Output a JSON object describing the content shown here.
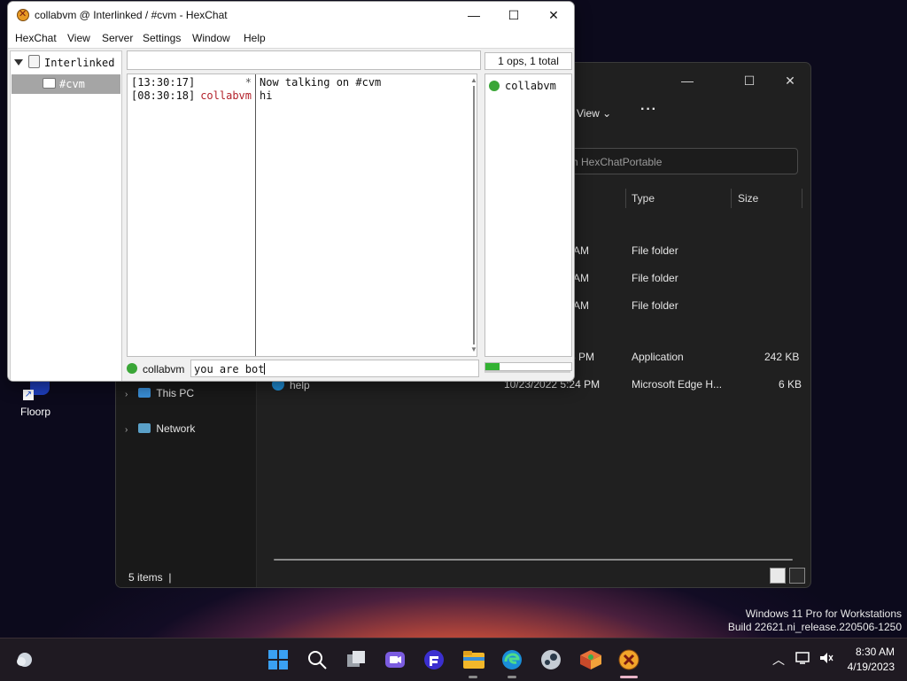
{
  "desktop": {
    "icon_label": "Floorp",
    "watermark_line1": "Windows 11 Pro for Workstations",
    "watermark_line2": "Build 22621.ni_release.220506-1250"
  },
  "explorer": {
    "view_label": "View",
    "more_label": "···",
    "search_placeholder": "h HexChatPortable",
    "columns": {
      "type": "Type",
      "size": "Size"
    },
    "rows": [
      {
        "date": "AM",
        "type": "File folder",
        "size": ""
      },
      {
        "date": "AM",
        "type": "File folder",
        "size": ""
      },
      {
        "date": "AM",
        "type": "File folder",
        "size": ""
      },
      {
        "date": "5 PM",
        "type": "Application",
        "size": "242 KB"
      },
      {
        "name": "help",
        "date": "10/23/2022 5:24 PM",
        "type": "Microsoft Edge H...",
        "size": "6 KB"
      }
    ],
    "nav": {
      "this_pc": "This PC",
      "network": "Network"
    },
    "status": "5 items"
  },
  "hexchat": {
    "title": "collabvm @ Interlinked / #cvm - HexChat",
    "menu": [
      "HexChat",
      "View",
      "Server",
      "Settings",
      "Window",
      "Help"
    ],
    "server": "Interlinked",
    "channel": "#cvm",
    "ops_label": "1 ops, 1 total",
    "messages": [
      {
        "time": "[13:30:17]",
        "nick": "*",
        "text": "Now talking on #cvm"
      },
      {
        "time": "[08:30:18]",
        "nick": "collabvm",
        "text": "hi"
      }
    ],
    "users": [
      "collabvm"
    ],
    "input_nick": "collabvm",
    "input_value": "you are bot"
  },
  "taskbar": {
    "time": "8:30 AM",
    "date": "4/19/2023"
  }
}
